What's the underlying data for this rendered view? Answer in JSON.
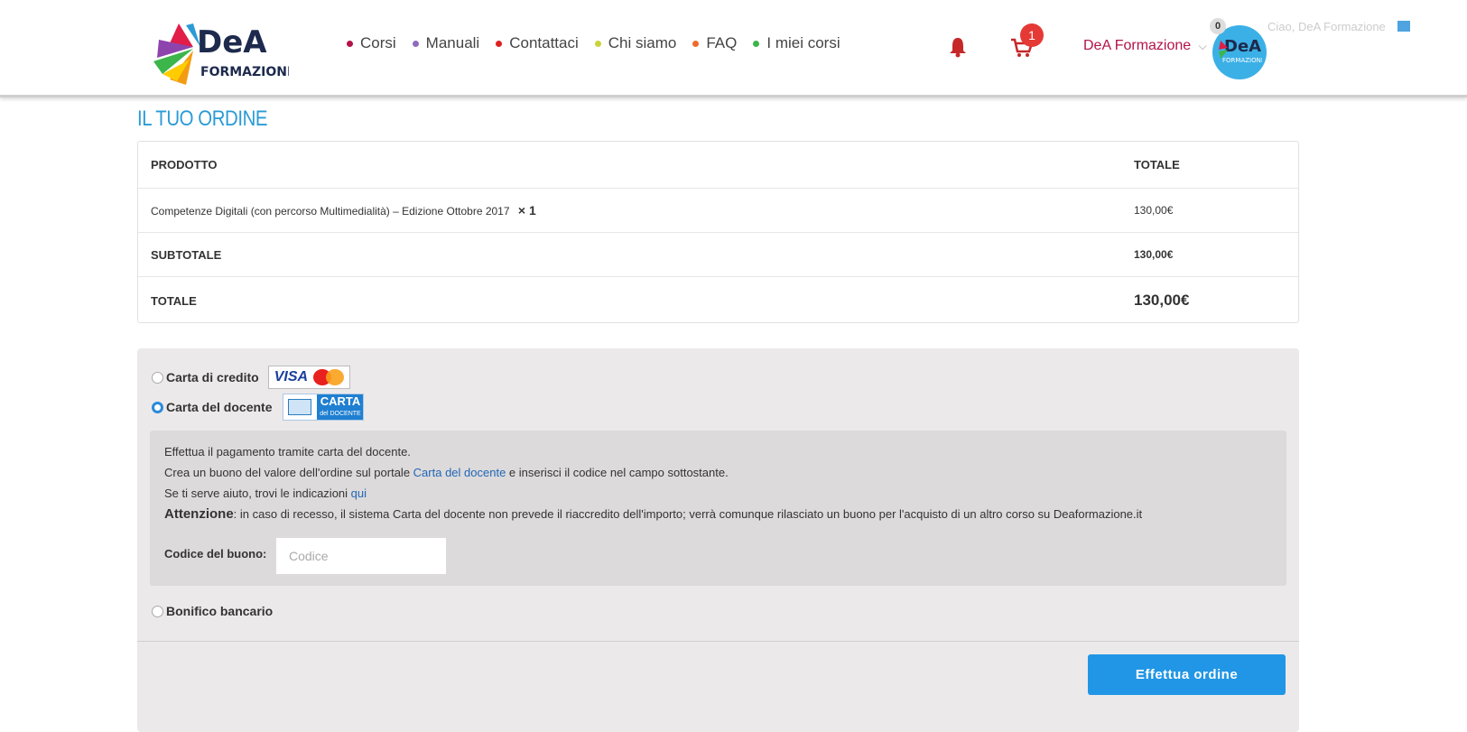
{
  "header": {
    "logo_text": "DeA",
    "logo_subtext": "FORMAZIONE",
    "nav": [
      {
        "label": "Corsi",
        "color": "#b3124a"
      },
      {
        "label": "Manuali",
        "color": "#8e6bbf"
      },
      {
        "label": "Contattaci",
        "color": "#e02020"
      },
      {
        "label": "Chi siamo",
        "color": "#c9d43a"
      },
      {
        "label": "FAQ",
        "color": "#f06a2a"
      },
      {
        "label": "I miei corsi",
        "color": "#3cb54a"
      }
    ],
    "cart_count": "1",
    "user_name": "DeA Formazione",
    "notifications_count": "0",
    "greeting": "Ciao, DeA Formazione"
  },
  "order": {
    "title": "IL TUO ORDINE",
    "col_product": "PRODOTTO",
    "col_total": "TOTALE",
    "item_name": "Competenze Digitali (con percorso Multimedialità) – Edizione Ottobre 2017",
    "item_qty": "× 1",
    "item_total": "130,00€",
    "subtotal_label": "SUBTOTALE",
    "subtotal_value": "130,00€",
    "total_label": "TOTALE",
    "total_value": "130,00€"
  },
  "payment": {
    "options": [
      {
        "label": "Carta di credito",
        "selected": false
      },
      {
        "label": "Carta del docente",
        "selected": true
      },
      {
        "label": "Bonifico bancario",
        "selected": false
      }
    ],
    "visa_text": "VISA",
    "mastercard_text": "MasterCard",
    "cdd_logo_text": "CARTA",
    "cdd_logo_subtext": "del DOCENTE",
    "desc_line1": "Effettua il pagamento tramite carta del docente.",
    "desc_line2_pre": "Crea un buono del valore dell'ordine sul portale ",
    "desc_line2_link": "Carta del docente",
    "desc_line2_post": " e inserisci il codice nel campo sottostante.",
    "desc_line3_pre": "Se ti serve aiuto, trovi le indicazioni ",
    "desc_line3_link": "qui",
    "att_label": "Attenzione",
    "att_text": ": in caso di recesso, il sistema Carta del docente non prevede il riaccredito dell'importo; verrà comunque rilasciato un buono per l'acquisto di un altro corso su Deaformazione.it",
    "code_label": "Codice del buono:",
    "code_placeholder": "Codice",
    "code_value": "",
    "submit_label": "Effettua ordine"
  }
}
